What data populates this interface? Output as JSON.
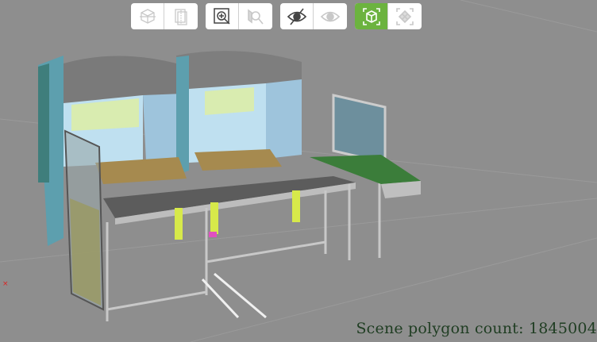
{
  "toolbar": {
    "groups": [
      {
        "buttons": [
          {
            "icon": "wireframe-cube-icon",
            "enabled": false
          },
          {
            "icon": "section-plane-icon",
            "enabled": false
          }
        ]
      },
      {
        "buttons": [
          {
            "icon": "zoom-in-icon",
            "enabled": true
          },
          {
            "icon": "zoom-selection-icon",
            "enabled": false
          }
        ]
      },
      {
        "buttons": [
          {
            "icon": "hide-icon",
            "enabled": true
          },
          {
            "icon": "show-icon",
            "enabled": false
          }
        ]
      },
      {
        "buttons": [
          {
            "icon": "fit-all-icon",
            "enabled": true,
            "active": true
          },
          {
            "icon": "fit-selection-icon",
            "enabled": false
          }
        ]
      }
    ],
    "accent": "#6cb33f"
  },
  "status": {
    "polygon_count_text": "Scene polygon count: 1845004"
  },
  "axis_marker": "×"
}
